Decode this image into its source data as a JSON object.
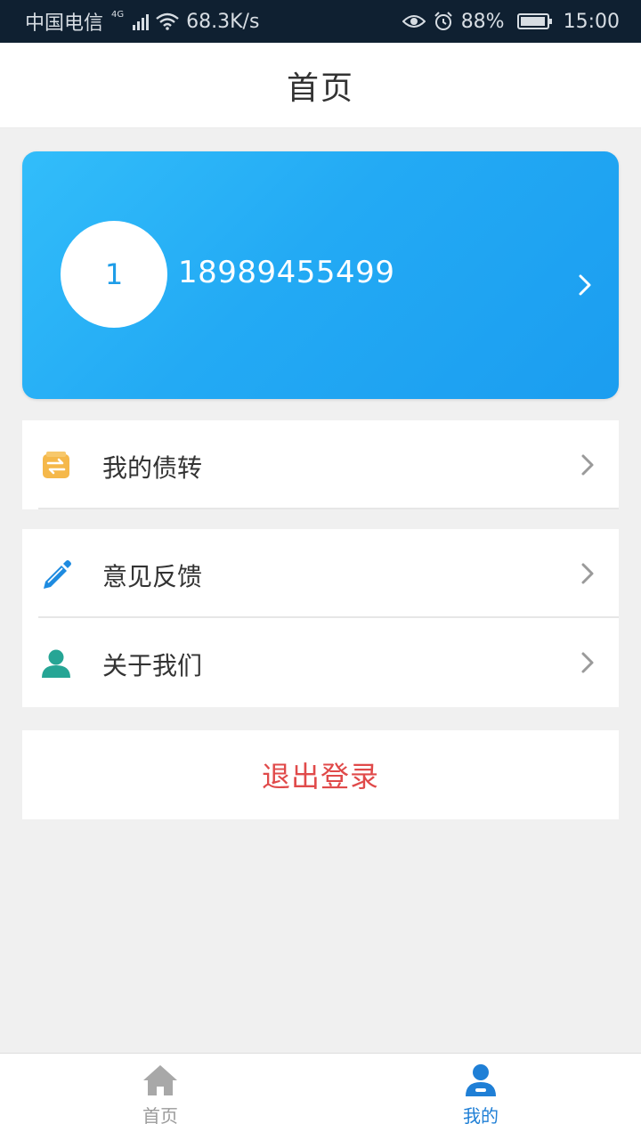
{
  "status_bar": {
    "carrier": "中国电信",
    "network_tag": "4G",
    "speed": "68.3K/s",
    "battery": "88%",
    "time": "15:00"
  },
  "header": {
    "title": "首页"
  },
  "profile": {
    "avatar_text": "1",
    "phone": "18989455499"
  },
  "menu": {
    "group1": [
      {
        "label": "我的债转",
        "icon": "transfer-icon",
        "color": "#f5b84a"
      }
    ],
    "group2": [
      {
        "label": "意见反馈",
        "icon": "pencil-icon",
        "color": "#1e8be0"
      },
      {
        "label": "关于我们",
        "icon": "person-icon",
        "color": "#26a595"
      }
    ]
  },
  "logout": {
    "label": "退出登录",
    "color": "#e04a4a"
  },
  "tab_bar": {
    "items": [
      {
        "label": "首页",
        "icon": "home-icon",
        "active": false
      },
      {
        "label": "我的",
        "icon": "user-icon",
        "active": true
      }
    ],
    "active_color": "#1f7fd6",
    "inactive_color": "#9b9b9b"
  }
}
